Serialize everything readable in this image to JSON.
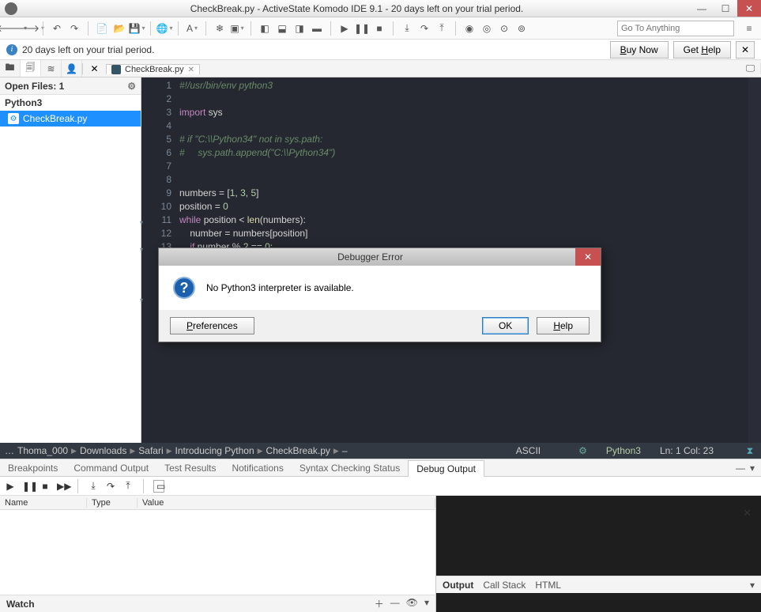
{
  "window": {
    "title": "CheckBreak.py - ActiveState Komodo IDE 9.1 - 20 days left on your trial period."
  },
  "toolbar": {
    "goto_placeholder": "Go To Anything"
  },
  "trial": {
    "message": "20 days left on your trial period.",
    "buy": "Buy Now",
    "help": "Get Help"
  },
  "sidebar": {
    "open_files_label": "Open Files: 1",
    "group": "Python3",
    "file": "CheckBreak.py"
  },
  "editor_tab": {
    "filename": "CheckBreak.py"
  },
  "code": {
    "l1": "#!/usr/bin/env python3",
    "l3a": "import",
    "l3b": " sys",
    "l5": "# if \"C:\\\\Python34\" not in sys.path:",
    "l6": "#     sys.path.append(\"C:\\\\Python34\")",
    "l9_a": "numbers ",
    "l9_b": "=",
    "l9_c": " [",
    "l9_d": "1",
    "l9_e": ", ",
    "l9_f": "3",
    "l9_g": ", ",
    "l9_h": "5",
    "l9_i": "]",
    "l10_a": "position ",
    "l10_b": "=",
    "l10_c": " ",
    "l10_d": "0",
    "l11_a": "while",
    "l11_b": " position ",
    "l11_c": "<",
    "l11_d": " ",
    "l11_e": "len",
    "l11_f": "(numbers):",
    "l12_a": "    number ",
    "l12_b": "=",
    "l12_c": " numbers[position]",
    "l13_a": "    ",
    "l13_b": "if",
    "l13_c": " number ",
    "l13_d": "%",
    "l13_e": " ",
    "l13_f": "2",
    "l13_g": " ",
    "l13_h": "==",
    "l13_i": " ",
    "l13_j": "0",
    "l13_k": ":"
  },
  "breadcrumb": {
    "seg0": "…",
    "seg1": "Thoma_000",
    "seg2": "Downloads",
    "seg3": "Safari",
    "seg4": "Introducing Python",
    "seg5": "CheckBreak.py",
    "seg6": "–",
    "encoding": "ASCII",
    "lang": "Python3",
    "linecol": "Ln: 1 Col: 23"
  },
  "bottom_tabs": {
    "t0": "Breakpoints",
    "t1": "Command Output",
    "t2": "Test Results",
    "t3": "Notifications",
    "t4": "Syntax Checking Status",
    "t5": "Debug Output"
  },
  "watch": {
    "col_name": "Name",
    "col_type": "Type",
    "col_value": "Value",
    "label": "Watch"
  },
  "output": {
    "out": "Output",
    "cs": "Call Stack",
    "html": "HTML"
  },
  "dialog": {
    "title": "Debugger Error",
    "message": "No Python3 interpreter is available.",
    "prefs": "Preferences",
    "ok": "OK",
    "help": "Help"
  }
}
